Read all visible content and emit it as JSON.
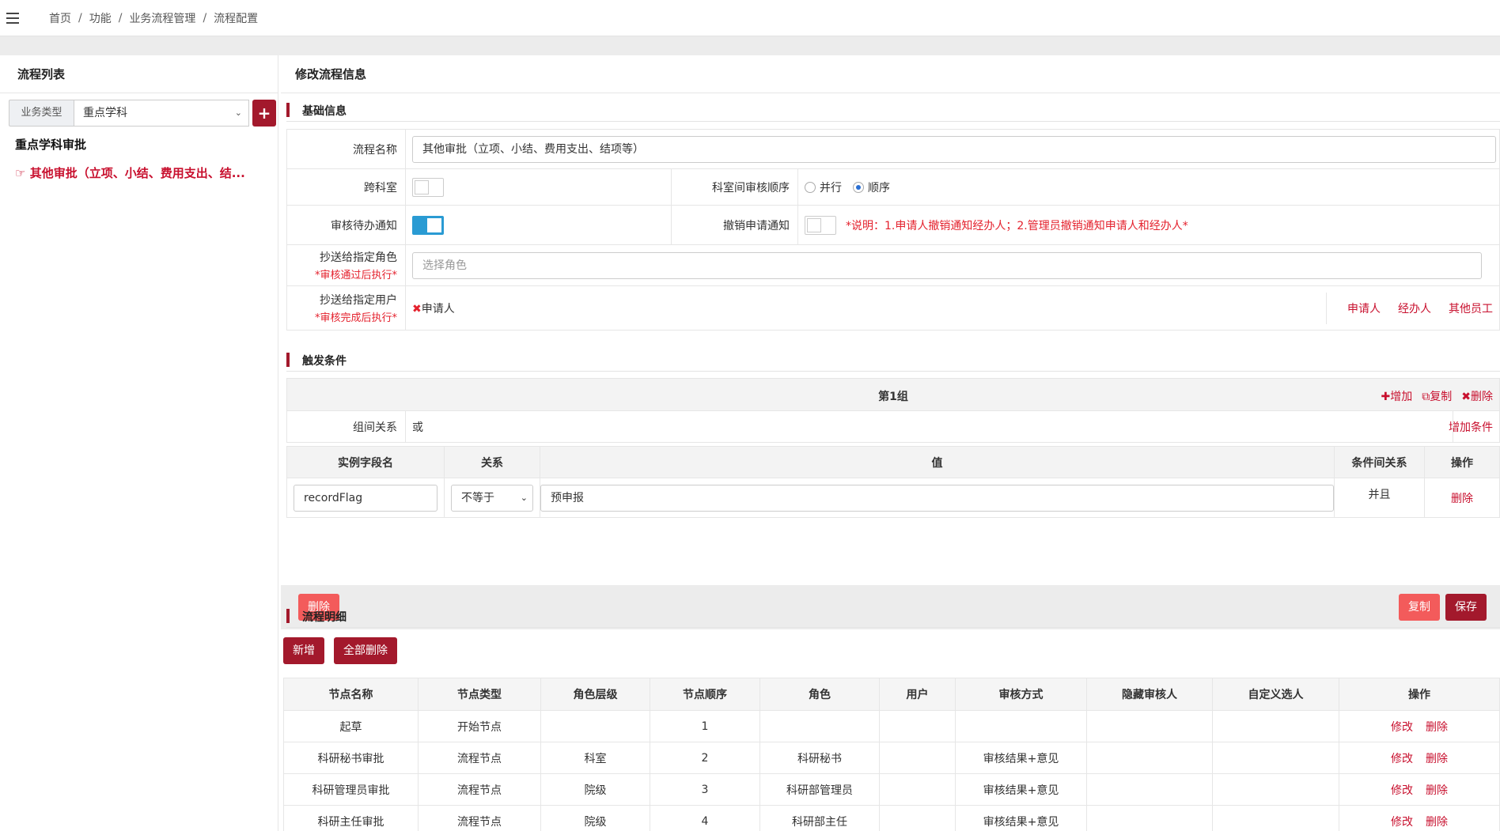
{
  "breadcrumb": [
    "首页",
    "功能",
    "业务流程管理",
    "流程配置"
  ],
  "left": {
    "title": "流程列表",
    "filter_label": "业务类型",
    "filter_value": "重点学科",
    "group": "重点学科审批",
    "active_item": "其他审批（立项、小结、费用支出、结..."
  },
  "main": {
    "title": "修改流程信息",
    "basic": {
      "section": "基础信息",
      "name_label": "流程名称",
      "name_value": "其他审批（立项、小结、费用支出、结项等）",
      "cross_label": "跨科室",
      "order_label": "科室间审核顺序",
      "order_options": [
        "并行",
        "顺序"
      ],
      "order_selected": "顺序",
      "notify_label": "审核待办通知",
      "revoke_label": "撤销申请通知",
      "revoke_note": "*说明：1.申请人撤销通知经办人；2.管理员撤销通知申请人和经办人*",
      "cc_role_label": "抄送给指定角色",
      "cc_role_req": "*审核通过后执行*",
      "cc_role_placeholder": "选择角色",
      "cc_user_label": "抄送给指定用户",
      "cc_user_req": "*审核完成后执行*",
      "cc_user_tag": "申请人",
      "cc_user_links": [
        "申请人",
        "经办人",
        "其他员工"
      ]
    },
    "trigger": {
      "section": "触发条件",
      "group_title": "第1组",
      "group_actions": [
        "增加",
        "复制",
        "删除"
      ],
      "relation_label": "组间关系",
      "relation_value": "或",
      "add_condition": "增加条件",
      "headers": [
        "实例字段名",
        "关系",
        "值",
        "条件间关系",
        "操作"
      ],
      "row": {
        "field": "recordFlag",
        "op": "不等于",
        "value": "预申报",
        "link": "并且",
        "action": "删除"
      }
    },
    "buttons": {
      "delete": "删除",
      "copy": "复制",
      "save": "保存"
    },
    "detail": {
      "section": "流程明细",
      "add": "新增",
      "delete_all": "全部删除",
      "headers": [
        "节点名称",
        "节点类型",
        "角色层级",
        "节点顺序",
        "角色",
        "用户",
        "审核方式",
        "隐藏审核人",
        "自定义选人",
        "操作"
      ],
      "rows": [
        [
          "起草",
          "开始节点",
          "",
          "1",
          "",
          "",
          "",
          "",
          ""
        ],
        [
          "科研秘书审批",
          "流程节点",
          "科室",
          "2",
          "科研秘书",
          "",
          "审核结果+意见",
          "",
          ""
        ],
        [
          "科研管理员审批",
          "流程节点",
          "院级",
          "3",
          "科研部管理员",
          "",
          "审核结果+意见",
          "",
          ""
        ],
        [
          "科研主任审批",
          "流程节点",
          "院级",
          "4",
          "科研部主任",
          "",
          "审核结果+意见",
          "",
          ""
        ]
      ],
      "row_ops": [
        "修改",
        "删除"
      ]
    }
  }
}
